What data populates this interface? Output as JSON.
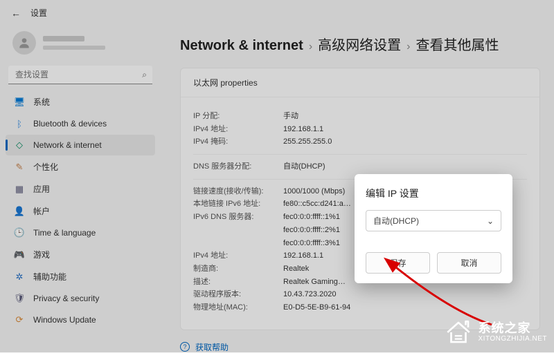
{
  "titlebar": {
    "label": "设置"
  },
  "search": {
    "placeholder": "查找设置"
  },
  "sidebar": {
    "items": [
      {
        "label": "系统",
        "icon": "display-icon",
        "color": "#0078d4"
      },
      {
        "label": "Bluetooth & devices",
        "icon": "bluetooth-icon",
        "color": "#3a8dde"
      },
      {
        "label": "Network & internet",
        "icon": "wifi-icon",
        "color": "#0a8a62",
        "active": true
      },
      {
        "label": "个性化",
        "icon": "personalize-icon",
        "color": "#c4824e"
      },
      {
        "label": "应用",
        "icon": "apps-icon",
        "color": "#5b5b7a"
      },
      {
        "label": "帐户",
        "icon": "accounts-icon",
        "color": "#d06a6a"
      },
      {
        "label": "Time & language",
        "icon": "time-icon",
        "color": "#4682b4"
      },
      {
        "label": "游戏",
        "icon": "gaming-icon",
        "color": "#6a6a6a"
      },
      {
        "label": "辅助功能",
        "icon": "accessibility-icon",
        "color": "#2a72c4"
      },
      {
        "label": "Privacy & security",
        "icon": "privacy-icon",
        "color": "#5b5b7a"
      },
      {
        "label": "Windows Update",
        "icon": "update-icon",
        "color": "#d88a3a"
      }
    ]
  },
  "breadcrumb": {
    "root": "Network & internet",
    "level2": "高级网络设置",
    "level3": "查看其他属性"
  },
  "card": {
    "header": "以太网 properties",
    "groups": [
      [
        {
          "label": "IP 分配:",
          "value": "手动"
        },
        {
          "label": "IPv4 地址:",
          "value": "192.168.1.1"
        },
        {
          "label": "IPv4 掩码:",
          "value": "255.255.255.0"
        }
      ],
      [
        {
          "label": "DNS 服务器分配:",
          "value": "自动(DHCP)"
        }
      ],
      [
        {
          "label": "链接速度(接收/传输):",
          "value": "1000/1000 (Mbps)"
        },
        {
          "label": "本地链接 IPv6 地址:",
          "value": "fe80::c5cc:d241:a…"
        },
        {
          "label": "IPv6 DNS 服务器:",
          "value": "fec0:0:0:ffff::1%1"
        },
        {
          "label": "",
          "value": "fec0:0:0:ffff::2%1"
        },
        {
          "label": "",
          "value": "fec0:0:0:ffff::3%1"
        },
        {
          "label": "IPv4 地址:",
          "value": "192.168.1.1"
        },
        {
          "label": "制造商:",
          "value": "Realtek"
        },
        {
          "label": "描述:",
          "value": "Realtek Gaming…"
        },
        {
          "label": "驱动程序版本:",
          "value": "10.43.723.2020"
        },
        {
          "label": "物理地址(MAC):",
          "value": "E0-D5-5E-B9-61-94"
        }
      ]
    ]
  },
  "help": {
    "label": "获取帮助"
  },
  "dialog": {
    "title": "编辑 IP 设置",
    "selected": "自动(DHCP)",
    "save": "保存",
    "cancel": "取消"
  },
  "watermark": {
    "brand": "系统之家",
    "url": "XITONGZHIJIA.NET"
  }
}
